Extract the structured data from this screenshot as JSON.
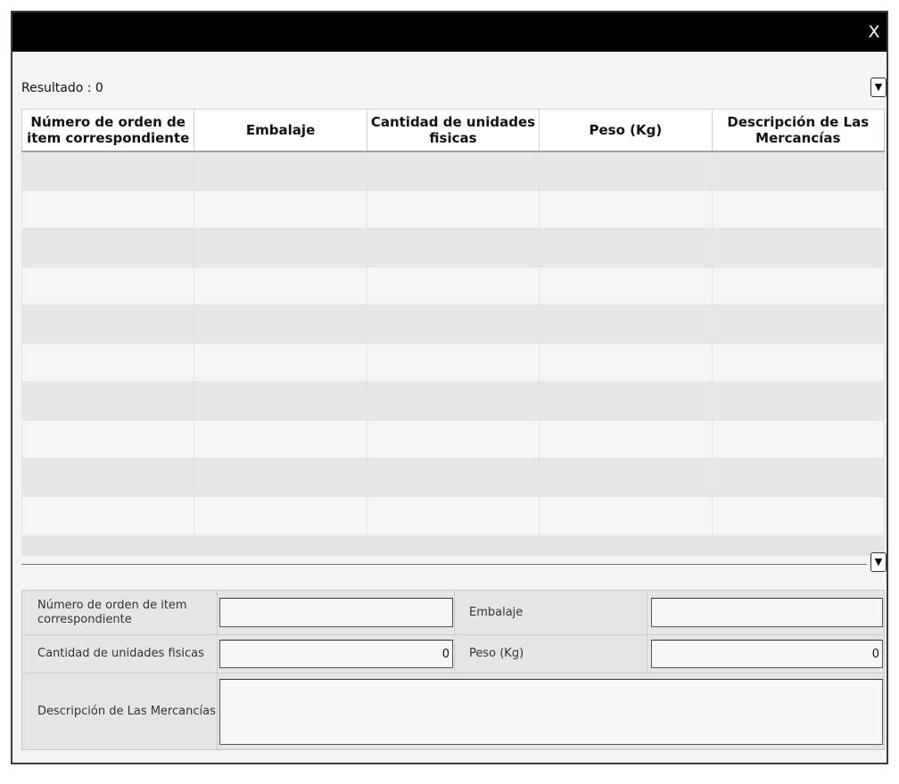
{
  "dialog": {
    "close_label": "X"
  },
  "results": {
    "label": "Resultado : 0"
  },
  "grid": {
    "columns": [
      "Número de orden de item correspondiente",
      "Embalaje",
      "Cantidad de unidades fisicas",
      "Peso (Kg)",
      "Descripción de Las Mercancías"
    ],
    "row_count": 10
  },
  "form": {
    "item_order_label": "Número de orden de item correspondiente",
    "item_order_value": "",
    "packaging_label": "Embalaje",
    "packaging_value": "",
    "units_label": "Cantidad de unidades fisicas",
    "units_value": "0",
    "weight_label": "Peso (Kg)",
    "weight_value": "0",
    "description_label": "Descripción de Las Mercancías",
    "description_value": ""
  },
  "icons": {
    "collapse": "chevron-down-icon"
  }
}
